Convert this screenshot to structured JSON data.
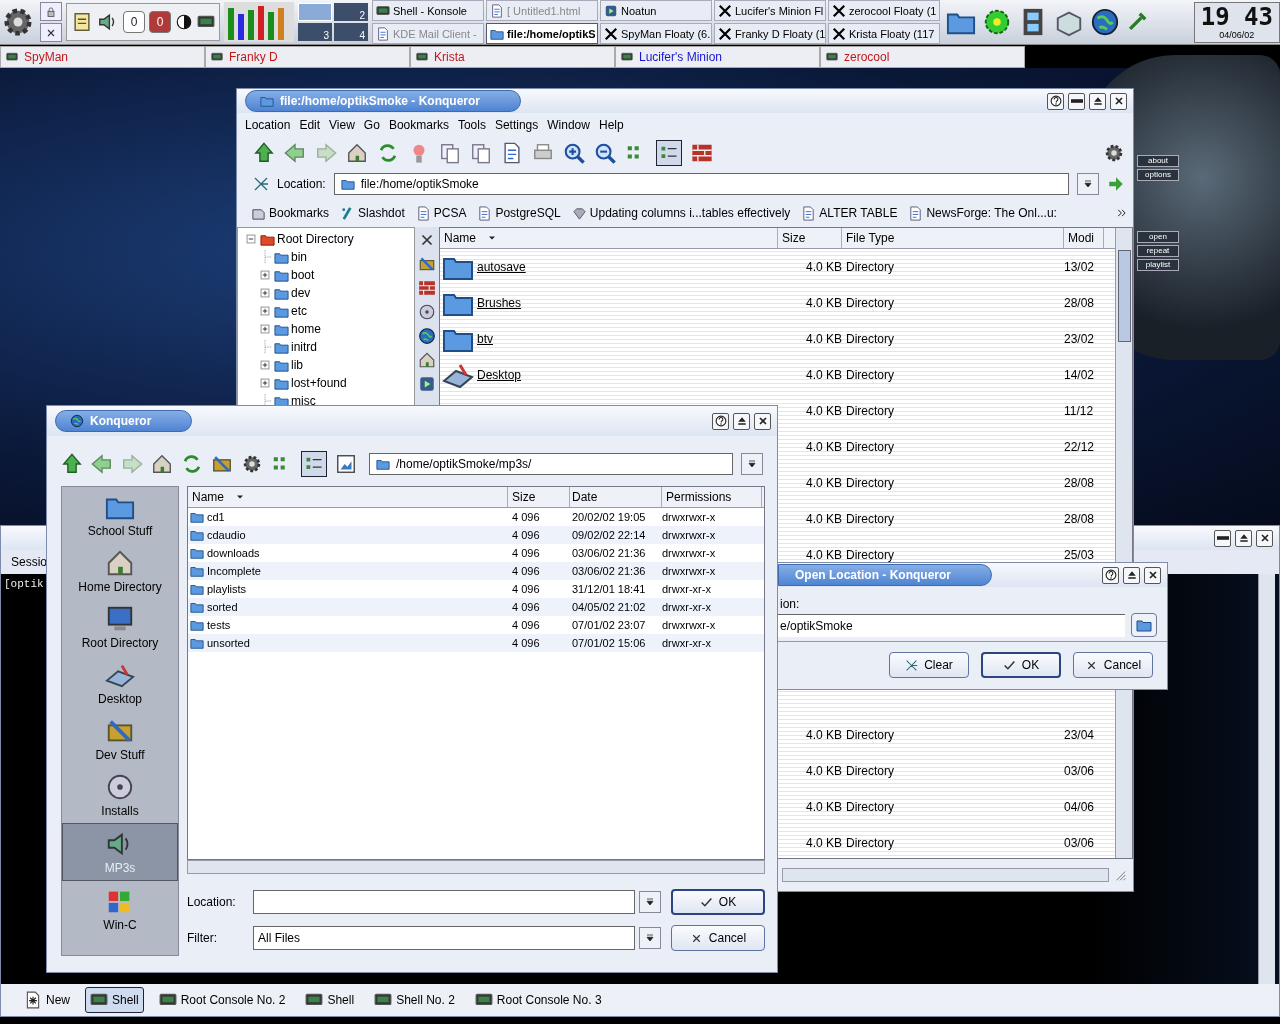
{
  "top_panel": {
    "counters": [
      {
        "value": "0",
        "alert": false
      },
      {
        "value": "0",
        "alert": true
      }
    ],
    "pager": [
      {
        "selected": true
      },
      {
        "label": "2",
        "selected": false
      },
      {
        "label": "3",
        "selected": false
      },
      {
        "label": "4",
        "selected": false
      }
    ],
    "tasks": [
      {
        "label": "Shell - Konsole",
        "kind": "terminal",
        "selected": false,
        "minimized": false
      },
      {
        "label": "[  Untitled1.html",
        "kind": "page",
        "selected": false,
        "minimized": true
      },
      {
        "label": "Noatun",
        "kind": "media",
        "selected": false,
        "minimized": false
      },
      {
        "label": "Lucifer's Minion Fl",
        "kind": "x",
        "selected": false,
        "minimized": false
      },
      {
        "label": "zerocool Floaty (1",
        "kind": "x",
        "selected": false,
        "minimized": false
      },
      {
        "label": "KDE Mail Client -",
        "kind": "page",
        "selected": false,
        "minimized": true
      },
      {
        "label": "file:/home/optikS",
        "kind": "folder",
        "selected": true,
        "minimized": false
      },
      {
        "label": "SpyMan Floaty (6.",
        "kind": "x",
        "selected": false,
        "minimized": false
      },
      {
        "label": "Franky D Floaty (1",
        "kind": "x",
        "selected": false,
        "minimized": false
      },
      {
        "label": "Krista Floaty (117",
        "kind": "x",
        "selected": false,
        "minimized": false
      }
    ],
    "clock": {
      "time": "19 43",
      "date": "04/06/02"
    }
  },
  "buddies": [
    {
      "name": "SpyMan",
      "color": "#c01818"
    },
    {
      "name": "Franky D",
      "color": "#c01818"
    },
    {
      "name": "Krista",
      "color": "#c01818"
    },
    {
      "name": "Lucifer's Minion",
      "color": "#1818d0"
    },
    {
      "name": "zerocool",
      "color": "#c01818"
    }
  ],
  "noatun": {
    "buttons": [
      "about",
      "options",
      "open",
      "repeat",
      "playlist"
    ]
  },
  "main_window": {
    "title": "file:/home/optikSmoke - Konqueror",
    "menu": [
      "Location",
      "Edit",
      "View",
      "Go",
      "Bookmarks",
      "Tools",
      "Settings",
      "Window",
      "Help"
    ],
    "location": {
      "label": "Location:",
      "value": "file:/home/optikSmoke"
    },
    "bookmarks": [
      {
        "label": "Bookmarks",
        "kind": "menu"
      },
      {
        "label": "Slashdot",
        "kind": "site"
      },
      {
        "label": "PCSA",
        "kind": "page"
      },
      {
        "label": "PostgreSQL",
        "kind": "page"
      },
      {
        "label": "Updating columns i...tables effectively",
        "kind": "gem"
      },
      {
        "label": "ALTER TABLE",
        "kind": "page"
      },
      {
        "label": "NewsForge: The Onl...u:",
        "kind": "page"
      }
    ],
    "tree": {
      "label": "Root Directory",
      "expanded": true,
      "children": [
        {
          "label": "bin",
          "has_children": false
        },
        {
          "label": "boot",
          "has_children": true
        },
        {
          "label": "dev",
          "has_children": true
        },
        {
          "label": "etc",
          "has_children": true
        },
        {
          "label": "home",
          "has_children": true
        },
        {
          "label": "initrd",
          "has_children": false
        },
        {
          "label": "lib",
          "has_children": true
        },
        {
          "label": "lost+found",
          "has_children": true
        },
        {
          "label": "misc",
          "has_children": false
        }
      ]
    },
    "columns": [
      "Name",
      "Size",
      "File Type",
      "Modi"
    ],
    "rows": [
      {
        "name": "autosave",
        "kind": "folder",
        "size": "4.0 KB",
        "type": "Directory",
        "modified": "13/02"
      },
      {
        "name": "Brushes",
        "kind": "folder",
        "size": "4.0 KB",
        "type": "Directory",
        "modified": "28/08"
      },
      {
        "name": "btv",
        "kind": "folder",
        "size": "4.0 KB",
        "type": "Directory",
        "modified": "23/02"
      },
      {
        "name": "Desktop",
        "kind": "desktop",
        "size": "4.0 KB",
        "type": "Directory",
        "modified": "14/02"
      },
      {
        "size": "4.0 KB",
        "type": "Directory",
        "modified": "11/12"
      },
      {
        "size": "4.0 KB",
        "type": "Directory",
        "modified": "22/12"
      },
      {
        "size": "4.0 KB",
        "type": "Directory",
        "modified": "28/08"
      },
      {
        "size": "4.0 KB",
        "type": "Directory",
        "modified": "28/08"
      },
      {
        "size": "4.0 KB",
        "type": "Directory",
        "modified": "25/03"
      }
    ],
    "rows_below_dialog": [
      {
        "size": "4.0 KB",
        "type": "Directory",
        "modified": "23/04"
      },
      {
        "size": "4.0 KB",
        "type": "Directory",
        "modified": "03/06"
      },
      {
        "size": "4.0 KB",
        "type": "Directory",
        "modified": "04/06"
      },
      {
        "size": "4.0 KB",
        "type": "Directory",
        "modified": "03/06"
      }
    ]
  },
  "file_dialog": {
    "title": "Konqueror",
    "path": "/home/optikSmoke/mp3s/",
    "places": [
      {
        "label": "School Stuff",
        "kind": "folder",
        "selected": false
      },
      {
        "label": "Home Directory",
        "kind": "home",
        "selected": false
      },
      {
        "label": "Root Directory",
        "kind": "computer",
        "selected": false
      },
      {
        "label": "Desktop",
        "kind": "desktop",
        "selected": false
      },
      {
        "label": "Dev Stuff",
        "kind": "tools",
        "selected": false
      },
      {
        "label": "Installs",
        "kind": "disk",
        "selected": false
      },
      {
        "label": "MP3s",
        "kind": "speaker",
        "selected": true
      },
      {
        "label": "Win-C",
        "kind": "windows",
        "selected": false
      }
    ],
    "columns": [
      "Name",
      "Size",
      "Date",
      "Permissions"
    ],
    "files": [
      {
        "name": "cd1",
        "size": "4 096",
        "date": "20/02/02 19:05",
        "permissions": "drwxrwxr-x"
      },
      {
        "name": "cdaudio",
        "size": "4 096",
        "date": "09/02/02 22:14",
        "permissions": "drwxrwxr-x"
      },
      {
        "name": "downloads",
        "size": "4 096",
        "date": "03/06/02 21:36",
        "permissions": "drwxrwxr-x"
      },
      {
        "name": "Incomplete",
        "size": "4 096",
        "date": "03/06/02 21:36",
        "permissions": "drwxrwxr-x"
      },
      {
        "name": "playlists",
        "size": "4 096",
        "date": "31/12/01 18:41",
        "permissions": "drwxr-xr-x"
      },
      {
        "name": "sorted",
        "size": "4 096",
        "date": "04/05/02 21:02",
        "permissions": "drwxr-xr-x"
      },
      {
        "name": "tests",
        "size": "4 096",
        "date": "07/01/02 23:07",
        "permissions": "drwxrwxr-x"
      },
      {
        "name": "unsorted",
        "size": "4 096",
        "date": "07/01/02 15:06",
        "permissions": "drwxr-xr-x"
      }
    ],
    "location_label": "Location:",
    "filter_label": "Filter:",
    "filter_value": "All Files",
    "ok": "OK",
    "cancel": "Cancel"
  },
  "open_location": {
    "title": "Open Location - Konqueror",
    "label": "ion:",
    "value": "e/optikSmoke",
    "buttons": [
      {
        "label": "Clear",
        "kind": "clear",
        "default": false
      },
      {
        "label": "OK",
        "kind": "ok",
        "default": true
      },
      {
        "label": "Cancel",
        "kind": "cancel",
        "default": false
      }
    ]
  },
  "konsole": {
    "menu_item": "Sessio",
    "line": "[optik",
    "tabs": [
      {
        "label": "New",
        "kind": "new",
        "selected": false
      },
      {
        "label": "Shell",
        "kind": "terminal",
        "selected": true
      },
      {
        "label": "Root Console No. 2",
        "kind": "terminal",
        "selected": false
      },
      {
        "label": "Shell",
        "kind": "terminal",
        "selected": false
      },
      {
        "label": "Shell No. 2",
        "kind": "terminal",
        "selected": false
      },
      {
        "label": "Root Console No. 3",
        "kind": "terminal",
        "selected": false
      }
    ]
  }
}
